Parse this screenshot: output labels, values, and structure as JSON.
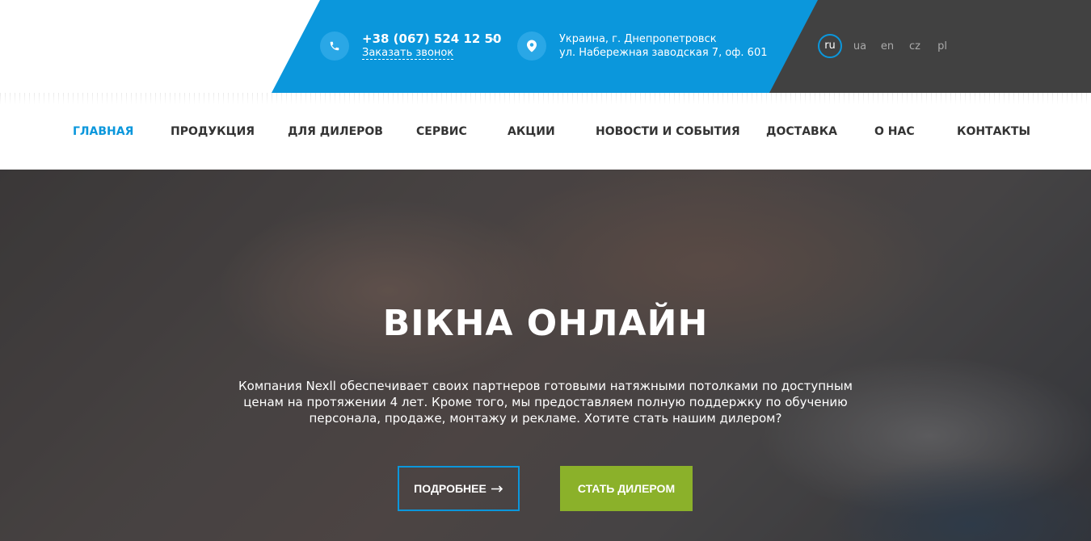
{
  "header": {
    "phone": "+38 (067) 524 12 50",
    "callback_label": "Заказать звонок",
    "address_line1": "Украина, г. Днепропетровск",
    "address_line2": "ул. Набережная заводская 7, оф. 601",
    "languages": [
      "ru",
      "ua",
      "en",
      "cz",
      "pl"
    ],
    "active_language": "ru"
  },
  "nav": {
    "items": [
      "ГЛАВНАЯ",
      "ПРОДУКЦИЯ",
      "ДЛЯ ДИЛЕРОВ",
      "СЕРВИС",
      "АКЦИИ",
      "НОВОСТИ И СОБЫТИЯ",
      "ДОСТАВКА",
      "О НАС",
      "КОНТАКТЫ"
    ],
    "active_index": 0
  },
  "hero": {
    "title": "ВІКНА ОНЛАЙН",
    "text": "Компания Nexll обеспечивает своих партнеров готовыми натяжными потолками по доступным ценам на протяжении 4 лет. Кроме того, мы предоставляем полную поддержку по обучению персонала, продаже, монтажу и рекламе. Хотите стать нашим дилером?",
    "more_button": "ПОДРОБНЕЕ",
    "dealer_button": "СТАТЬ ДИЛЕРОМ"
  },
  "colors": {
    "accent_blue": "#0b97dc",
    "dark_panel": "#414141",
    "green_button": "#8bb12a"
  }
}
